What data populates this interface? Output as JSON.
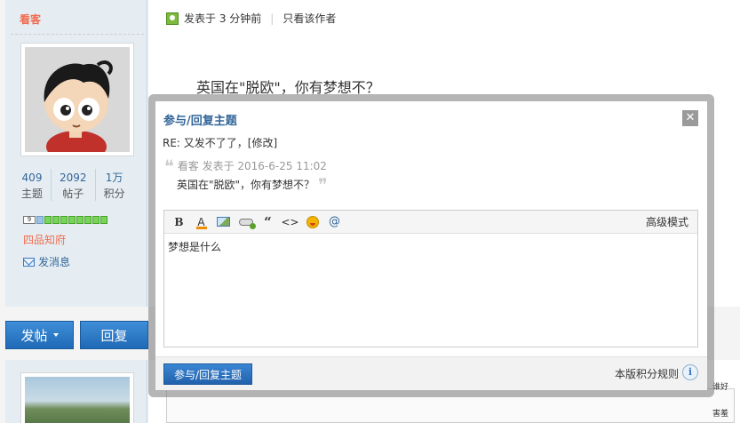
{
  "author": {
    "username": "看客",
    "stats": [
      {
        "value": "409",
        "label": "主题"
      },
      {
        "value": "2092",
        "label": "帖子"
      },
      {
        "value": "1万",
        "label": "积分"
      }
    ],
    "level_number": "9",
    "rank": "四品知府",
    "send_message": "发消息"
  },
  "post": {
    "posted": "发表于 3 分钟前",
    "author_only": "只看该作者",
    "body": "英国在\"脱欧\"，你有梦想不？"
  },
  "actions": {
    "new_post": "发帖",
    "reply": "回复"
  },
  "modal": {
    "title": "参与/回复主题",
    "close": "✕",
    "subject": "RE: 又发不了了，[修改]",
    "quote_author_line": "看客 发表于 2016-6-25 11:02",
    "quote_text": "英国在\"脱欧\"，你有梦想不？",
    "editor": {
      "toolbar": {
        "bold": "B",
        "color": "A",
        "quote": "“",
        "code": "<>",
        "at": "@",
        "advanced_mode": "高级模式"
      },
      "content": "梦想是什么"
    },
    "submit": "参与/回复主题",
    "rules": "本版积分规则",
    "info": "i"
  },
  "next_post": {
    "badge_top": "谁好",
    "badge_bottom": "害羞"
  },
  "colors": {
    "accent_blue": "#2a6fbf",
    "link_blue": "#336699",
    "username_orange": "#f26c4f",
    "sidebar_bg": "#e5edf2"
  }
}
